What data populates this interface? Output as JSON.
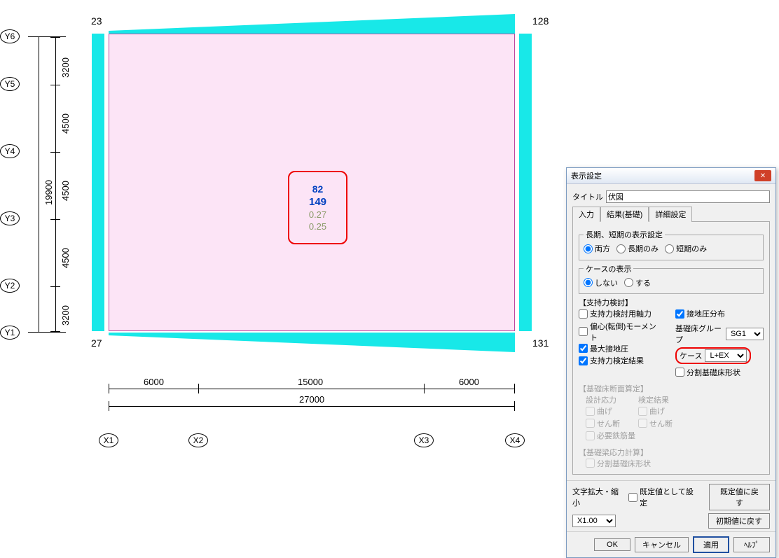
{
  "diagram": {
    "y_axis": {
      "labels": [
        "Y6",
        "Y5",
        "Y4",
        "Y3",
        "Y2",
        "Y1"
      ],
      "spans": [
        "3200",
        "4500",
        "4500",
        "4500",
        "3200"
      ],
      "total": "19900"
    },
    "x_axis": {
      "labels": [
        "X1",
        "X2",
        "X3",
        "X4"
      ],
      "spans": [
        "6000",
        "15000",
        "6000"
      ],
      "total": "27000"
    },
    "corners": {
      "tl": "23",
      "tr": "128",
      "bl": "27",
      "br": "131"
    },
    "center_box": {
      "v1": "82",
      "v2": "149",
      "v3": "0.27",
      "v4": "0.25"
    }
  },
  "dialog": {
    "title": "表示設定",
    "field_title_label": "タイトル",
    "field_title_value": "伏図",
    "tabs": {
      "input": "入力",
      "result": "結果(基礎)",
      "detail": "詳細設定"
    },
    "group_period": {
      "legend": "長期、短期の表示設定",
      "both": "両方",
      "long_only": "長期のみ",
      "short_only": "短期のみ",
      "selected": "both"
    },
    "group_case_display": {
      "legend": "ケースの表示",
      "no": "しない",
      "yes": "する",
      "selected": "no"
    },
    "group_bearing": {
      "legend": "【支持力検討】",
      "axial": "支持力検討用軸力",
      "eccentric": "偏心(転倒)モーメント",
      "max_pressure": "最大接地圧",
      "result": "支持力検定結果",
      "pressure_dist": "接地圧分布",
      "group_label": "基礎床グループ",
      "group_value": "SG1",
      "case_label": "ケース",
      "case_value": "L+EX",
      "split_shape": "分割基礎床形状",
      "checks": {
        "axial": false,
        "eccentric": false,
        "max_pressure": true,
        "result": true,
        "pressure_dist": true,
        "split_shape": false
      }
    },
    "group_section": {
      "legend": "【基礎床断面算定】",
      "design_stress": "設計応力",
      "check_result": "検定結果",
      "bending": "曲げ",
      "shear": "せん断",
      "req_rebar": "必要鉄筋量"
    },
    "group_beamstress": {
      "legend": "【基礎梁応力計算】",
      "split_shape": "分割基礎床形状"
    },
    "zoom": {
      "label": "文字拡大・縮小",
      "as_default_label": "既定値として設定",
      "value": "X1.00"
    },
    "buttons": {
      "restore_default_top": "既定値に戻す",
      "restore_initial": "初期値に戻す",
      "ok": "OK",
      "cancel": "キャンセル",
      "apply": "適用",
      "help": "ﾍﾙﾌﾟ"
    }
  }
}
